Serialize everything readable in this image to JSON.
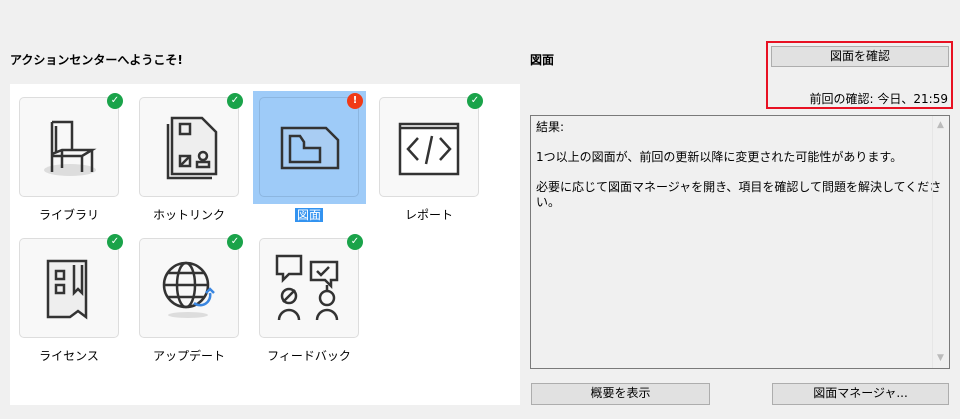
{
  "welcome": "アクションセンターへようこそ!",
  "tiles": [
    {
      "label": "ライブラリ",
      "status": "ok",
      "icon": "chair-icon"
    },
    {
      "label": "ホットリンク",
      "status": "ok",
      "icon": "hotlink-document-icon"
    },
    {
      "label": "図面",
      "status": "warning",
      "icon": "drawing-icon",
      "selected": true
    },
    {
      "label": "レポート",
      "status": "ok",
      "icon": "code-report-icon"
    },
    {
      "label": "ライセンス",
      "status": "ok",
      "icon": "license-icon"
    },
    {
      "label": "アップデート",
      "status": "ok",
      "icon": "globe-update-icon"
    },
    {
      "label": "フィードバック",
      "status": "ok",
      "icon": "feedback-icon"
    }
  ],
  "badges": {
    "ok": "✓",
    "warning": "!"
  },
  "detail": {
    "title": "図面",
    "check_button": "図面を確認",
    "last_check": "前回の確認: 今日、21:59",
    "results_heading": "結果:",
    "results_line1": "1つ以上の図面が、前回の更新以降に変更された可能性があります。",
    "results_line2": "必要に応じて図面マネージャを開き、項目を確認して問題を解決してください。",
    "summary_button": "概要を表示",
    "manager_button": "図面マネージャ..."
  }
}
